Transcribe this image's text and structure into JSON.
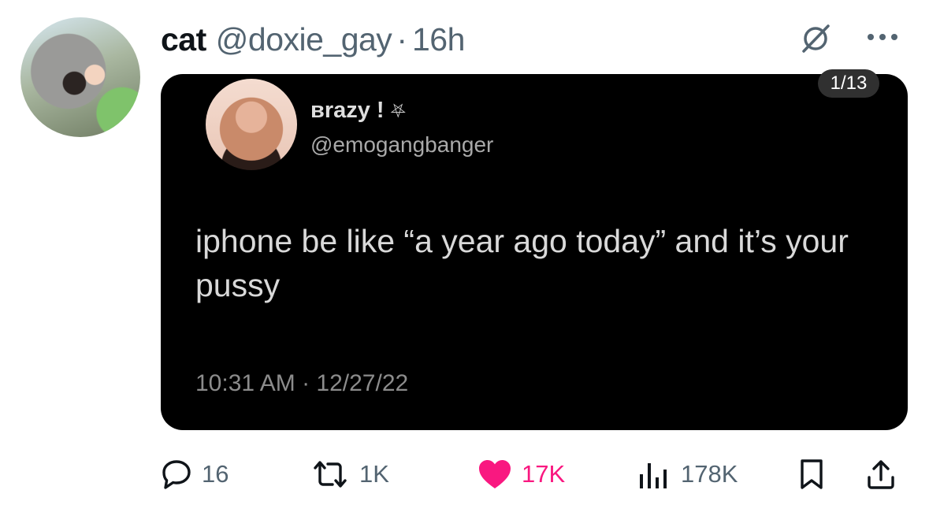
{
  "tweet": {
    "author_name": "cat",
    "author_handle": "@doxie_gay",
    "separator": "·",
    "time_ago": "16h"
  },
  "media": {
    "counter": "1/13",
    "quoted": {
      "name": "вrazy !",
      "name_symbol": "⛧",
      "handle": "@emogangbanger",
      "text": "iphone be like “a year ago today” and it’s your pussy",
      "timestamp": "10:31 AM · 12/27/22"
    }
  },
  "actions": {
    "replies": "16",
    "retweets": "1K",
    "likes": "17K",
    "views": "178K"
  },
  "icons": {
    "reply": "reply-icon",
    "retweet": "retweet-icon",
    "like": "heart-icon",
    "views": "analytics-icon",
    "bookmark": "bookmark-icon",
    "share": "share-icon",
    "grok": "grok-icon",
    "more": "more-icon"
  },
  "colors": {
    "like_active": "#f91880",
    "secondary_text": "#536471",
    "primary_text": "#0f1419",
    "media_background": "#000000"
  }
}
